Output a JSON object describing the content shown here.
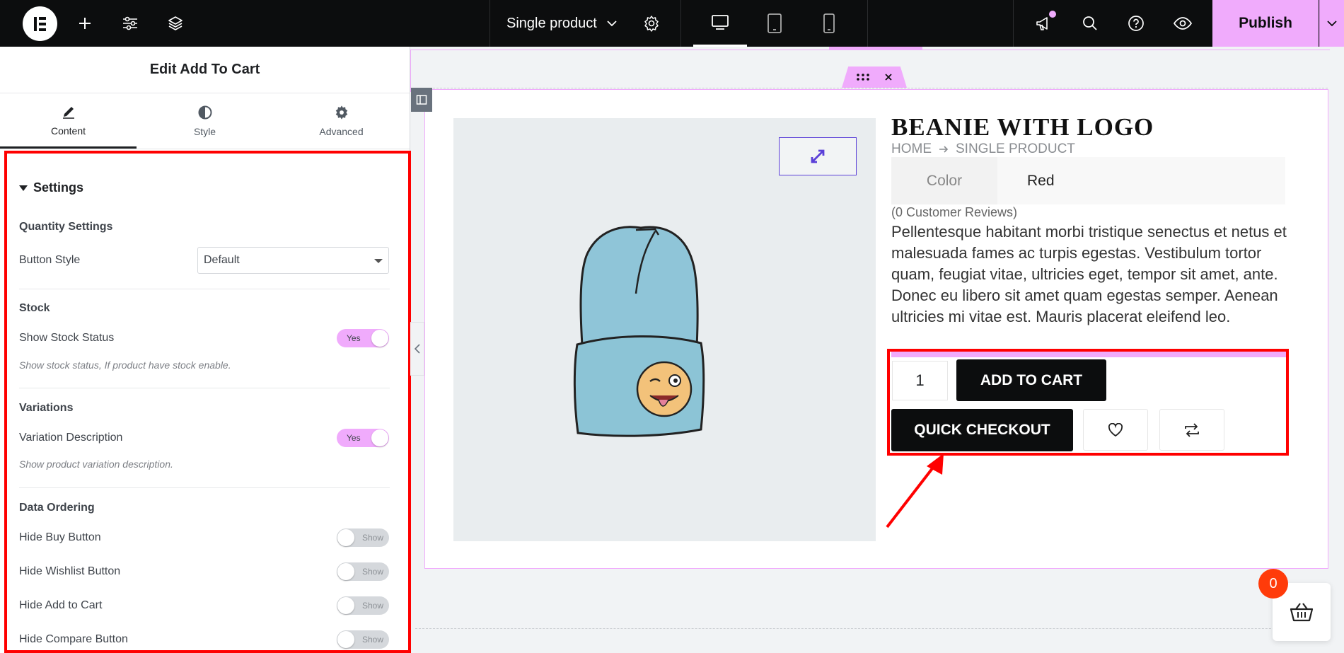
{
  "topbar": {
    "document_title": "Single product",
    "publish_label": "Publish",
    "icons": [
      "elementor-logo-icon",
      "add-icon",
      "sliders-icon",
      "layers-icon",
      "chevron-down-icon",
      "gear-icon",
      "desktop-icon",
      "tablet-icon",
      "mobile-icon",
      "megaphone-icon",
      "search-icon",
      "help-icon",
      "eye-icon",
      "chevron-down-icon"
    ]
  },
  "panel": {
    "title": "Edit Add To Cart",
    "tabs": [
      {
        "label": "Content",
        "icon": "pencil-icon"
      },
      {
        "label": "Style",
        "icon": "contrast-icon"
      },
      {
        "label": "Advanced",
        "icon": "gear-icon"
      }
    ],
    "section_title": "Settings",
    "quantity_heading": "Quantity Settings",
    "button_style_label": "Button Style",
    "button_style_value": "Default",
    "stock_heading": "Stock",
    "show_stock_label": "Show Stock Status",
    "show_stock_value": "Yes",
    "show_stock_hint": "Show stock status, If product have stock enable.",
    "variations_heading": "Variations",
    "variation_desc_label": "Variation Description",
    "variation_desc_value": "Yes",
    "variation_desc_hint": "Show product variation description.",
    "ordering_heading": "Data Ordering",
    "hide_buy_label": "Hide Buy Button",
    "hide_buy_value": "Show",
    "hide_wishlist_label": "Hide Wishlist Button",
    "hide_wishlist_value": "Show",
    "hide_cart_label": "Hide Add to Cart",
    "hide_cart_value": "Show",
    "hide_compare_label": "Hide Compare Button",
    "hide_compare_value": "Show"
  },
  "product": {
    "title": "BEANIE WITH LOGO",
    "breadcrumb_home": "HOME",
    "breadcrumb_current": "SINGLE PRODUCT",
    "attr_key": "Color",
    "attr_value": "Red",
    "reviews": "(0 Customer Reviews)",
    "description": "Pellentesque habitant morbi tristique senectus et netus et malesuada fames ac turpis egestas. Vestibulum tortor quam, feugiat vitae, ultricies eget, tempor sit amet, ante. Donec eu libero sit amet quam egestas semper. Aenean ultricies mi vitae est. Mauris placerat eleifend leo.",
    "quantity": "1",
    "add_to_cart_label": "ADD TO CART",
    "quick_checkout_label": "QUICK CHECKOUT"
  },
  "cart": {
    "count": "0"
  },
  "colors": {
    "accent": "#f0abfc",
    "highlight": "#ff0000",
    "dark": "#0c0d0e"
  }
}
